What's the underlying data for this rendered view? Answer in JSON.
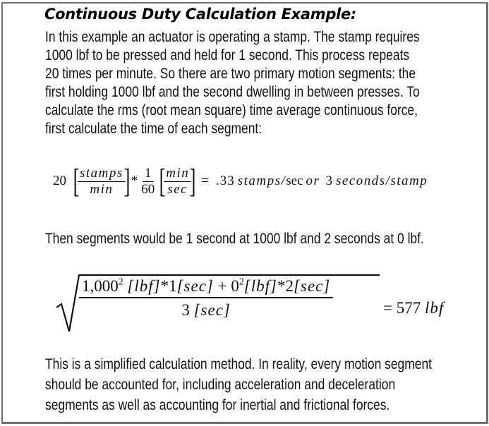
{
  "title": "Continuous Duty Calculation Example:",
  "intro_lines": [
    "In this example an actuator is operating a stamp.  The stamp requires",
    "1000 lbf to be pressed and held for 1 second. This process repeats",
    "20 times per minute.  So there are two primary motion segments: the",
    "first holding 1000 lbf and the second dwelling in between presses.  To",
    "calculate the rms (root mean square) time average continuous force,",
    "first calculate the time of each segment:"
  ],
  "equation1": {
    "coefficient": "20",
    "frac1_num": "stamps",
    "frac1_den": "min",
    "times": "*",
    "frac2_num": "1",
    "frac2_den": "60",
    "frac3_num": "min",
    "frac3_den": "sec",
    "equals": "=",
    "result_value": ".33",
    "result_unit_a": "stamps/",
    "result_unit_b": "sec",
    "or": "or",
    "alt_value": "3",
    "alt_unit": "seconds/stamp"
  },
  "segments_line": "Then segments would be 1 second at 1000 lbf and 2 seconds at 0 lbf.",
  "equation2": {
    "term1_base": "1,000",
    "term1_exp": "2",
    "term1_unit": "[lbf]",
    "term1_mult": "*1",
    "term1_time": "[sec]",
    "plus": "+",
    "term2_base": "0",
    "term2_exp": "2",
    "term2_unit": "[lbf]",
    "term2_mult": "*2",
    "term2_time": "[sec]",
    "denominator_value": "3",
    "denominator_unit": "[sec]",
    "equals": "=",
    "result": "577",
    "result_unit": "lbf"
  },
  "closing_lines": [
    "This is a simplified calculation method.  In reality, every motion segment",
    "should be accounted for, including acceleration and deceleration",
    "segments as well as accounting for inertial and frictional forces."
  ]
}
